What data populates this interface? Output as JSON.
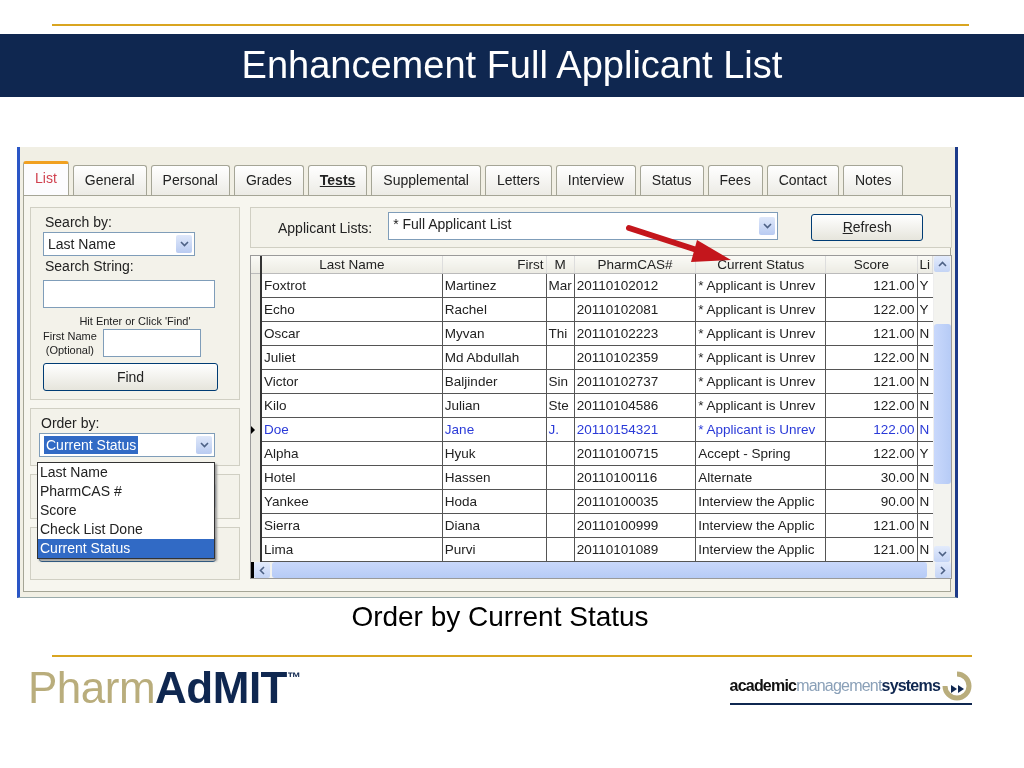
{
  "slide": {
    "title": "Enhancement Full Applicant List",
    "caption": "Order by Current Status"
  },
  "window": {
    "tabs": [
      {
        "label": "List",
        "selected": true,
        "emphasized": false
      },
      {
        "label": "General",
        "selected": false,
        "emphasized": false
      },
      {
        "label": "Personal",
        "selected": false,
        "emphasized": false
      },
      {
        "label": "Grades",
        "selected": false,
        "emphasized": false
      },
      {
        "label": "Tests",
        "selected": false,
        "emphasized": true
      },
      {
        "label": "Supplemental",
        "selected": false,
        "emphasized": false
      },
      {
        "label": "Letters",
        "selected": false,
        "emphasized": false
      },
      {
        "label": "Interview",
        "selected": false,
        "emphasized": false
      },
      {
        "label": "Status",
        "selected": false,
        "emphasized": false
      },
      {
        "label": "Fees",
        "selected": false,
        "emphasized": false
      },
      {
        "label": "Contact",
        "selected": false,
        "emphasized": false
      },
      {
        "label": "Notes",
        "selected": false,
        "emphasized": false
      }
    ],
    "search_panel": {
      "search_by_label": "Search by:",
      "search_by_value": "Last Name",
      "search_string_label": "Search String:",
      "hint": "Hit Enter or Click 'Find'",
      "first_name_label": "First Name\n(Optional)",
      "find_button": "Find"
    },
    "order_panel": {
      "label": "Order by:",
      "value": "Current Status",
      "expanded": true,
      "options": [
        {
          "label": "Last Name",
          "selected": false
        },
        {
          "label": "PharmCAS #",
          "selected": false
        },
        {
          "label": "Score",
          "selected": false
        },
        {
          "label": "Check List Done",
          "selected": false
        },
        {
          "label": "Current Status",
          "selected": true
        }
      ]
    },
    "applicant_lists": {
      "label": "Applicant Lists:",
      "value": "* Full Applicant List",
      "refresh_button": "Refresh"
    },
    "table": {
      "columns": [
        {
          "label": "Last Name"
        },
        {
          "label": "First"
        },
        {
          "label": "M"
        },
        {
          "label": "PharmCAS#"
        },
        {
          "label": "Current Status"
        },
        {
          "label": "Score"
        },
        {
          "label": "Li"
        }
      ],
      "rows": [
        {
          "selected": false,
          "cells": [
            "Foxtrot",
            "Martinez",
            "Mar",
            "20110102012",
            "* Applicant is Unrev",
            "121.00",
            "Y"
          ]
        },
        {
          "selected": false,
          "cells": [
            "Echo",
            "Rachel",
            "",
            "20110102081",
            "* Applicant is Unrev",
            "122.00",
            "Y"
          ]
        },
        {
          "selected": false,
          "cells": [
            "Oscar",
            "Myvan",
            "Thi",
            "20110102223",
            "* Applicant is Unrev",
            "121.00",
            "N"
          ]
        },
        {
          "selected": false,
          "cells": [
            "Juliet",
            "Md Abdullah",
            "",
            "20110102359",
            "* Applicant is Unrev",
            "122.00",
            "N"
          ]
        },
        {
          "selected": false,
          "cells": [
            "Victor",
            "Baljinder",
            "Sin",
            "20110102737",
            "* Applicant is Unrev",
            "121.00",
            "N"
          ]
        },
        {
          "selected": false,
          "cells": [
            "Kilo",
            "Julian",
            "Ste",
            "20110104586",
            "* Applicant is Unrev",
            "122.00",
            "N"
          ]
        },
        {
          "selected": true,
          "cells": [
            "Doe",
            "Jane",
            "J.",
            "20110154321",
            "* Applicant is Unrev",
            "122.00",
            "N"
          ]
        },
        {
          "selected": false,
          "cells": [
            "Alpha",
            "Hyuk",
            "",
            "20110100715",
            "Accept - Spring",
            "122.00",
            "Y"
          ]
        },
        {
          "selected": false,
          "cells": [
            "Hotel",
            "Hassen",
            "",
            "20110100116",
            "Alternate",
            "30.00",
            "N"
          ]
        },
        {
          "selected": false,
          "cells": [
            "Yankee",
            "Hoda",
            "",
            "20110100035",
            "Interview the Applic",
            "90.00",
            "N"
          ]
        },
        {
          "selected": false,
          "cells": [
            "Sierra",
            "Diana",
            "",
            "20110100999",
            "Interview the Applic",
            "121.00",
            "N"
          ]
        },
        {
          "selected": false,
          "cells": [
            "Lima",
            "Purvi",
            "",
            "20110101089",
            "Interview the Applic",
            "121.00",
            "N"
          ]
        }
      ]
    }
  },
  "footer": {
    "product_logo": [
      "Pharm",
      "AdMIT",
      "™"
    ],
    "company_logo": [
      "academic",
      "management",
      "systems"
    ]
  }
}
